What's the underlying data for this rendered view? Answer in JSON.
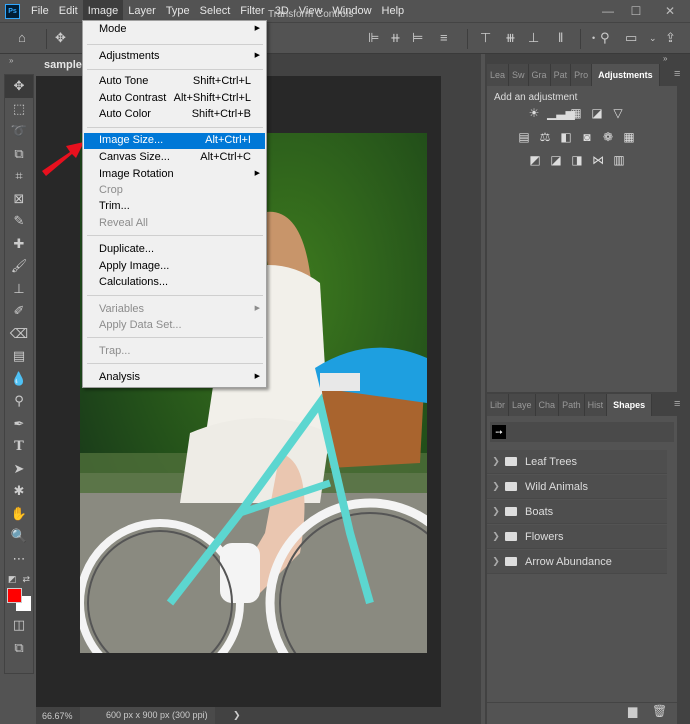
{
  "app": {
    "logo": "Ps"
  },
  "menubar": {
    "items": [
      "File",
      "Edit",
      "Image",
      "Layer",
      "Type",
      "Select",
      "Filter",
      "3D",
      "View",
      "Window",
      "Help"
    ],
    "active": "Image"
  },
  "window_controls": {
    "minimize": "—",
    "maximize": "☐",
    "close": "✕"
  },
  "options_bar": {
    "transform_controls_label": "Transform Controls"
  },
  "document": {
    "tab_title": "sample.",
    "zoom": "66.67%",
    "info": "600 px x 900 px (300 ppi)",
    "info_arrow": "❯"
  },
  "image_menu": {
    "items": [
      {
        "label": "Mode",
        "shortcut": "",
        "submenu": true,
        "disabled": false
      },
      {
        "label": "Adjustments",
        "shortcut": "",
        "submenu": true,
        "disabled": false
      },
      {
        "label": "Auto Tone",
        "shortcut": "Shift+Ctrl+L",
        "submenu": false,
        "disabled": false
      },
      {
        "label": "Auto Contrast",
        "shortcut": "Alt+Shift+Ctrl+L",
        "submenu": false,
        "disabled": false
      },
      {
        "label": "Auto Color",
        "shortcut": "Shift+Ctrl+B",
        "submenu": false,
        "disabled": false
      },
      {
        "label": "Image Size...",
        "shortcut": "Alt+Ctrl+I",
        "submenu": false,
        "disabled": false,
        "highlighted": true
      },
      {
        "label": "Canvas Size...",
        "shortcut": "Alt+Ctrl+C",
        "submenu": false,
        "disabled": false
      },
      {
        "label": "Image Rotation",
        "shortcut": "",
        "submenu": true,
        "disabled": false
      },
      {
        "label": "Crop",
        "shortcut": "",
        "submenu": false,
        "disabled": true
      },
      {
        "label": "Trim...",
        "shortcut": "",
        "submenu": false,
        "disabled": false
      },
      {
        "label": "Reveal All",
        "shortcut": "",
        "submenu": false,
        "disabled": true
      },
      {
        "label": "Duplicate...",
        "shortcut": "",
        "submenu": false,
        "disabled": false
      },
      {
        "label": "Apply Image...",
        "shortcut": "",
        "submenu": false,
        "disabled": false
      },
      {
        "label": "Calculations...",
        "shortcut": "",
        "submenu": false,
        "disabled": false
      },
      {
        "label": "Variables",
        "shortcut": "",
        "submenu": true,
        "disabled": true
      },
      {
        "label": "Apply Data Set...",
        "shortcut": "",
        "submenu": false,
        "disabled": true
      },
      {
        "label": "Trap...",
        "shortcut": "",
        "submenu": false,
        "disabled": true
      },
      {
        "label": "Analysis",
        "shortcut": "",
        "submenu": true,
        "disabled": false
      }
    ]
  },
  "adjustments_panel": {
    "tabs": [
      "Lea",
      "Sw",
      "Gra",
      "Pat",
      "Pro",
      "Adjustments"
    ],
    "active_tab": "Adjustments",
    "heading": "Add an adjustment",
    "rows": [
      [
        "brightness-contrast",
        "levels",
        "curves",
        "exposure",
        "vibrance"
      ],
      [
        "hue-saturation",
        "color-balance",
        "black-white",
        "photo-filter",
        "channel-mixer",
        "color-lookup"
      ],
      [
        "invert",
        "posterize",
        "threshold",
        "selective-color",
        "gradient-map"
      ]
    ]
  },
  "shapes_panel": {
    "tabs": [
      "Libr",
      "Laye",
      "Cha",
      "Path",
      "Hist",
      "Shapes"
    ],
    "active_tab": "Shapes",
    "groups": [
      "Leaf Trees",
      "Wild Animals",
      "Boats",
      "Flowers",
      "Arrow Abundance"
    ]
  },
  "colors": {
    "foreground": "#ff0000",
    "background": "#ffffff",
    "menu_highlight": "#0078d7",
    "annotation_arrow": "#e8101e"
  }
}
